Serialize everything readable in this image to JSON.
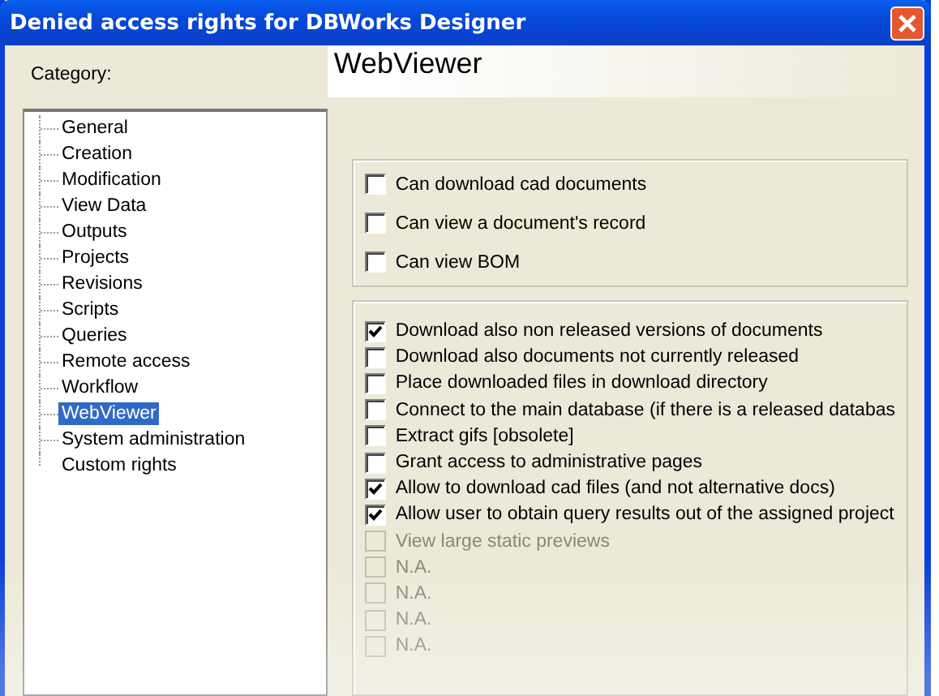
{
  "window": {
    "title": "Denied access rights for DBWorks Designer"
  },
  "category_label": "Category:",
  "tree": {
    "items": [
      {
        "label": "General",
        "selected": false
      },
      {
        "label": "Creation",
        "selected": false
      },
      {
        "label": "Modification",
        "selected": false
      },
      {
        "label": "View Data",
        "selected": false
      },
      {
        "label": "Outputs",
        "selected": false
      },
      {
        "label": "Projects",
        "selected": false
      },
      {
        "label": "Revisions",
        "selected": false
      },
      {
        "label": "Scripts",
        "selected": false
      },
      {
        "label": "Queries",
        "selected": false
      },
      {
        "label": "Remote access",
        "selected": false
      },
      {
        "label": "Workflow",
        "selected": false
      },
      {
        "label": "WebViewer",
        "selected": true
      },
      {
        "label": "System administration",
        "selected": false
      },
      {
        "label": "Custom rights",
        "selected": false
      }
    ]
  },
  "page_title": "WebViewer",
  "groups": [
    {
      "items": [
        {
          "label": "Can download cad documents",
          "checked": false,
          "disabled": false
        },
        {
          "label": "Can view a document's record",
          "checked": false,
          "disabled": false
        },
        {
          "label": "Can view BOM",
          "checked": false,
          "disabled": false
        }
      ]
    },
    {
      "items": [
        {
          "label": "Download also non released versions of documents",
          "checked": true,
          "disabled": false
        },
        {
          "label": "Download also documents not currently released",
          "checked": false,
          "disabled": false
        },
        {
          "label": "Place downloaded files in download directory",
          "checked": false,
          "disabled": false
        },
        {
          "label": "Connect to the main database (if there is a released databas",
          "checked": false,
          "disabled": false
        },
        {
          "label": "Extract gifs [obsolete]",
          "checked": false,
          "disabled": false
        },
        {
          "label": "Grant access to administrative pages",
          "checked": false,
          "disabled": false
        },
        {
          "label": "Allow to download cad files (and not alternative docs)",
          "checked": true,
          "disabled": false
        },
        {
          "label": "Allow user to obtain query results out of the assigned project",
          "checked": true,
          "disabled": false
        },
        {
          "label": "View large static previews",
          "checked": false,
          "disabled": true
        },
        {
          "label": "N.A.",
          "checked": false,
          "disabled": true
        },
        {
          "label": "N.A.",
          "checked": false,
          "disabled": true
        },
        {
          "label": "N.A.",
          "checked": false,
          "disabled": true
        },
        {
          "label": "N.A.",
          "checked": false,
          "disabled": true
        }
      ]
    }
  ]
}
